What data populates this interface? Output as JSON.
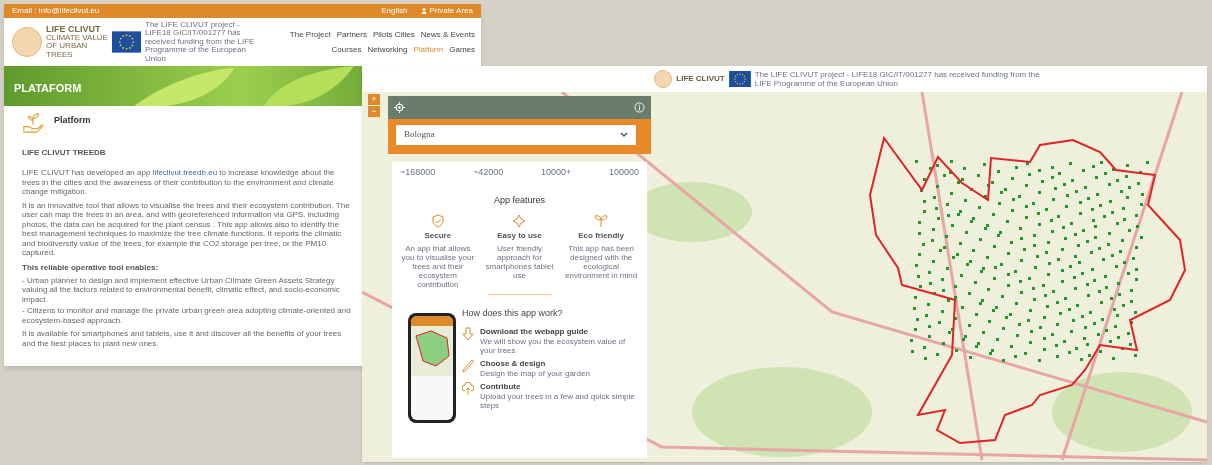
{
  "site_page": {
    "top_bar": {
      "email": "Email : info@lifeclivut.eu",
      "language": "English",
      "account": "Private Area"
    },
    "logo": {
      "title": "LIFE CLIVUT",
      "subtitle": "CLIMATE VALUE OF URBAN TREES"
    },
    "eu_note": "The LIFE CLIVUT project - LIFE18 GIC/IT/001277 has received funding from the LIFE Programme of the European Union",
    "nav": [
      {
        "label": "The Project",
        "selected": false
      },
      {
        "label": "Partners",
        "selected": false
      },
      {
        "label": "Pilots Cities",
        "selected": false
      },
      {
        "label": "News & Events",
        "selected": false
      },
      {
        "label": "Courses",
        "selected": false
      },
      {
        "label": "Networking",
        "selected": false
      },
      {
        "label": "Platform",
        "selected": true
      },
      {
        "label": "Games",
        "selected": false
      }
    ],
    "banner_title": "PLATAFORM",
    "section_title": "Platform",
    "subheading": "LIFE CLIVUT TREEDB",
    "intro": {
      "before": "LIFE CLIVUT has developed an app ",
      "link": "lifeclivut.treedb.eu",
      "after": " to increase knowledge about the trees in the cities and the awareness of their contribution to the environment and climate change mitigation."
    },
    "description": "It is an innovative tool that allows to visualise the trees and their ecosystem contribution. The user can map the trees in an area, and with georeferenced information via GPS, including photos, the data can be acquired for the plant census . This app allows also to identify the best management techniques to maximize the tree climate functions. It reports the climatic and biodiversity value of the trees, for example the CO2 storage per tree, or the PM10 captured.",
    "list_heading": "This reliable operative tool enables:",
    "list_items": [
      "- Urban planner to design and implement effective Urban Climate Green Assets Strategy valuing all the factors related to environmental benefit, climatic effect, and socio-economic impact.",
      "- Citizens to monitor and manage the private urban green area adopting climate-oriented and ecosystem-based approach."
    ],
    "closing": "It is available for smartphones and tablets, use it and discover all the benefits of your trees and the best places to plant new ones."
  },
  "app_page": {
    "logo_title": "LIFE CLIVUT",
    "eu_note": "The LIFE CLIVUT project - LIFE18 GIC/IT/001277 has received funding from the LIFE Programme of the European Union",
    "zoom_buttons": [
      "+",
      "−"
    ],
    "city_select": {
      "value": "Bologna"
    },
    "stats": [
      "~168000",
      "~42000",
      "10000+",
      "100000"
    ],
    "features_title": "App features",
    "features": [
      {
        "kind": "shield",
        "title": "Secure",
        "text": "An app that allows you to visualise your trees and their ecosystem contribution"
      },
      {
        "kind": "sparkle",
        "title": "Easy to use",
        "text": "User friendly approach for smartphones tablet use"
      },
      {
        "kind": "sprout",
        "title": "Eco friendly",
        "text": "This app has been designed with the ecological environment in mind"
      }
    ],
    "steps_title": "How does this app work?",
    "steps": [
      {
        "kind": "download",
        "title": "Download the webapp guide",
        "text": "We will show you the ecosystem value of your trees"
      },
      {
        "kind": "pencil",
        "title": "Choose & design",
        "text": "Design the map of your garden"
      },
      {
        "kind": "upload",
        "title": "Contribute",
        "text": "Upload your trees in a few and quick simple steps"
      }
    ]
  }
}
